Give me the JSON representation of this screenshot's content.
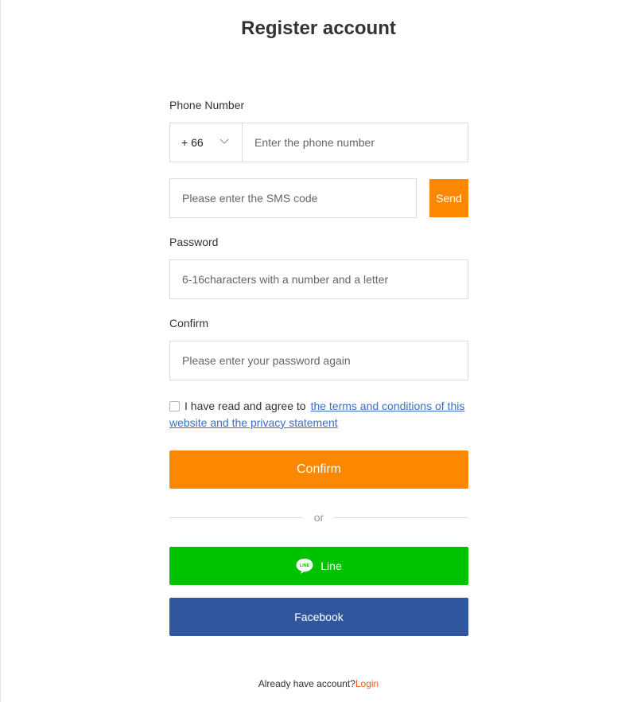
{
  "page": {
    "title": "Register account"
  },
  "phone": {
    "label": "Phone Number",
    "country_code": "+ 66",
    "placeholder": "Enter the phone number"
  },
  "sms": {
    "placeholder": "Please enter the SMS code",
    "send_label": "Send"
  },
  "password": {
    "label": "Password",
    "placeholder": "6-16characters with a number and a letter"
  },
  "confirm_password": {
    "label": "Confirm",
    "placeholder": "Please enter your password again"
  },
  "agreement": {
    "text": "I have read and agree to",
    "link_text": "the terms and conditions of this website and the privacy statement"
  },
  "actions": {
    "confirm_label": "Confirm",
    "or_label": "or",
    "line_label": "Line",
    "line_icon_text": "LINE",
    "facebook_label": "Facebook"
  },
  "footer": {
    "text": "Already have account?",
    "login_label": "Login"
  },
  "colors": {
    "accent": "#fb8800",
    "line_green": "#00c300",
    "facebook_blue": "#30579d",
    "link_blue": "#3a6fc4",
    "login_orange": "#f15a24"
  },
  "icons": {
    "country_dropdown": "chevron-down-icon",
    "line": "line-logo-icon"
  }
}
